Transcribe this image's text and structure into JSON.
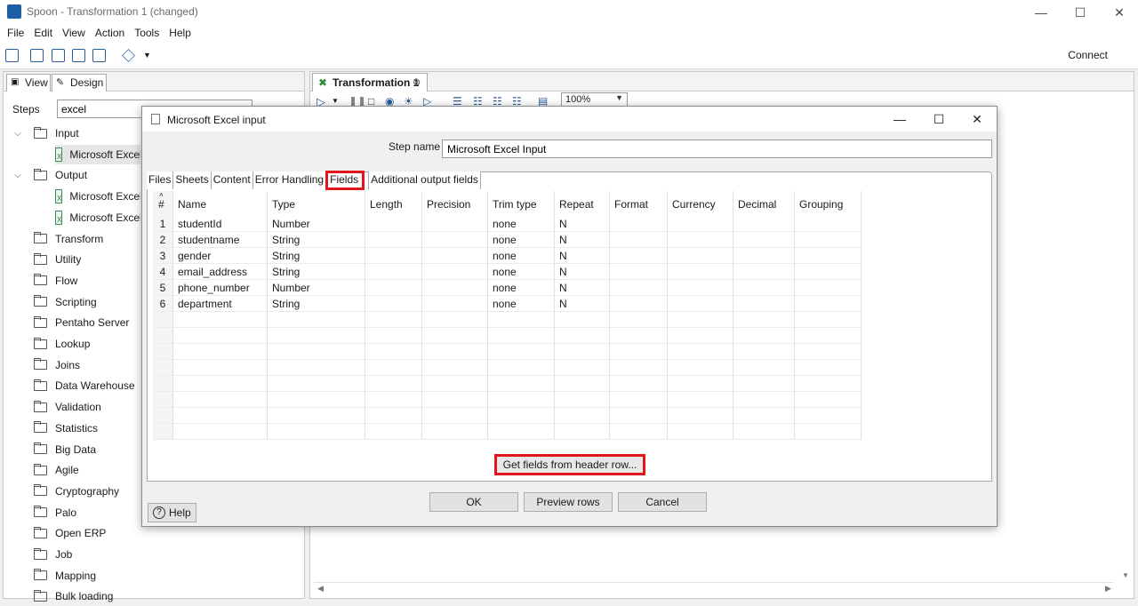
{
  "window": {
    "title": "Spoon - Transformation 1 (changed)"
  },
  "menu": [
    "File",
    "Edit",
    "View",
    "Action",
    "Tools",
    "Help"
  ],
  "toolbar": {
    "connect": "Connect"
  },
  "left_panel": {
    "tabs": [
      "View",
      "Design"
    ],
    "steps_label": "Steps",
    "steps_search": "excel",
    "tree": [
      {
        "label": "Input",
        "kind": "folder",
        "expanded": true,
        "indent": 0
      },
      {
        "label": "Microsoft Excel Input",
        "kind": "step",
        "indent": 1
      },
      {
        "label": "Output",
        "kind": "folder",
        "expanded": true,
        "indent": 0
      },
      {
        "label": "Microsoft Excel Output",
        "kind": "step",
        "indent": 1
      },
      {
        "label": "Microsoft Excel Writer",
        "kind": "step",
        "indent": 1
      },
      {
        "label": "Transform",
        "kind": "folder",
        "indent": 0
      },
      {
        "label": "Utility",
        "kind": "folder",
        "indent": 0
      },
      {
        "label": "Flow",
        "kind": "folder",
        "indent": 0
      },
      {
        "label": "Scripting",
        "kind": "folder",
        "indent": 0
      },
      {
        "label": "Pentaho Server",
        "kind": "folder",
        "indent": 0
      },
      {
        "label": "Lookup",
        "kind": "folder",
        "indent": 0
      },
      {
        "label": "Joins",
        "kind": "folder",
        "indent": 0
      },
      {
        "label": "Data Warehouse",
        "kind": "folder",
        "indent": 0
      },
      {
        "label": "Validation",
        "kind": "folder",
        "indent": 0
      },
      {
        "label": "Statistics",
        "kind": "folder",
        "indent": 0
      },
      {
        "label": "Big Data",
        "kind": "folder",
        "indent": 0
      },
      {
        "label": "Agile",
        "kind": "folder",
        "indent": 0
      },
      {
        "label": "Cryptography",
        "kind": "folder",
        "indent": 0
      },
      {
        "label": "Palo",
        "kind": "folder",
        "indent": 0
      },
      {
        "label": "Open ERP",
        "kind": "folder",
        "indent": 0
      },
      {
        "label": "Job",
        "kind": "folder",
        "indent": 0
      },
      {
        "label": "Mapping",
        "kind": "folder",
        "indent": 0
      },
      {
        "label": "Bulk loading",
        "kind": "folder",
        "indent": 0
      }
    ]
  },
  "canvas": {
    "tab_label": "Transformation 1",
    "zoom": "100%"
  },
  "dialog": {
    "title": "Microsoft Excel input",
    "step_name_label": "Step name",
    "step_name_value": "Microsoft Excel Input",
    "tabs": [
      "Files",
      "Sheets",
      "Content",
      "Error Handling",
      "Fields",
      "Additional output fields"
    ],
    "active_tab": "Fields",
    "columns": [
      "#",
      "Name",
      "Type",
      "Length",
      "Precision",
      "Trim type",
      "Repeat",
      "Format",
      "Currency",
      "Decimal",
      "Grouping"
    ],
    "rows": [
      [
        "1",
        "studentId",
        "Number",
        "",
        "",
        "none",
        "N",
        "",
        "",
        "",
        ""
      ],
      [
        "2",
        "studentname",
        "String",
        "",
        "",
        "none",
        "N",
        "",
        "",
        "",
        ""
      ],
      [
        "3",
        "gender",
        "String",
        "",
        "",
        "none",
        "N",
        "",
        "",
        "",
        ""
      ],
      [
        "4",
        "email_address",
        "String",
        "",
        "",
        "none",
        "N",
        "",
        "",
        "",
        ""
      ],
      [
        "5",
        "phone_number",
        "Number",
        "",
        "",
        "none",
        "N",
        "",
        "",
        "",
        ""
      ],
      [
        "6",
        "department",
        "String",
        "",
        "",
        "none",
        "N",
        "",
        "",
        "",
        ""
      ]
    ],
    "get_fields_button": "Get fields from header row...",
    "ok_button": "OK",
    "preview_button": "Preview rows",
    "cancel_button": "Cancel",
    "help_button": "Help"
  },
  "colors": {
    "highlight": "#e0161c",
    "accent": "#1f5fa8"
  }
}
